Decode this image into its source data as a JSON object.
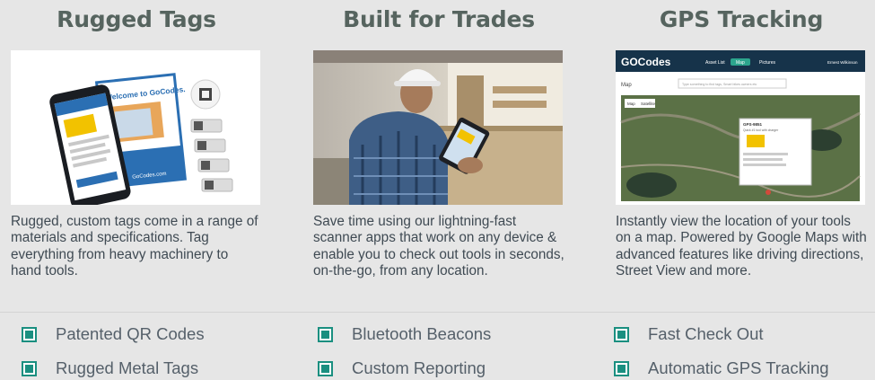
{
  "columns": [
    {
      "title": "Rugged Tags",
      "image_alt": "GoCodes welcome kit with phone and metal tags",
      "description": "Rugged, custom tags come in a range of materials and specifications. Tag everything from heavy machinery to hand tools.",
      "booklet_heading": "Welcome to GoCodes.",
      "booklet_footer": "GoCodes.com"
    },
    {
      "title": "Built for Trades",
      "image_alt": "Tradesman in plaid shirt using tablet in workshop",
      "description": "Save time using our lightning-fast scanner apps that work on any device & enable you to check out tools in seconds, on-the-go, from any location."
    },
    {
      "title": "GPS Tracking",
      "image_alt": "GoCodes web app map view",
      "description": "Instantly view the location of your tools on a map. Powered by Google Maps with advanced features like driving directions, Street View and more.",
      "app": {
        "logo": "GOCodes",
        "nav": [
          "Asset List",
          "Map",
          "Pictures"
        ],
        "user": "Ernest Wilkinson",
        "map_title": "Map",
        "search_placeholder": "Type something to find tags, Smart bikes owners etc",
        "tabs": [
          "Map",
          "Satellite"
        ],
        "popup_title": "GPS-9851",
        "popup_sub": "Quick #1 tool with charger"
      }
    }
  ],
  "features": [
    [
      "Patented QR Codes",
      "Rugged Metal Tags"
    ],
    [
      "Bluetooth Beacons",
      "Custom Reporting"
    ],
    [
      "Fast Check Out",
      "Automatic GPS Tracking"
    ]
  ],
  "colors": {
    "background": "#e6e6e6",
    "title": "#56645f",
    "body_text": "#3f4a53",
    "check_accent": "#1a8f80",
    "app_header": "#16334a"
  }
}
